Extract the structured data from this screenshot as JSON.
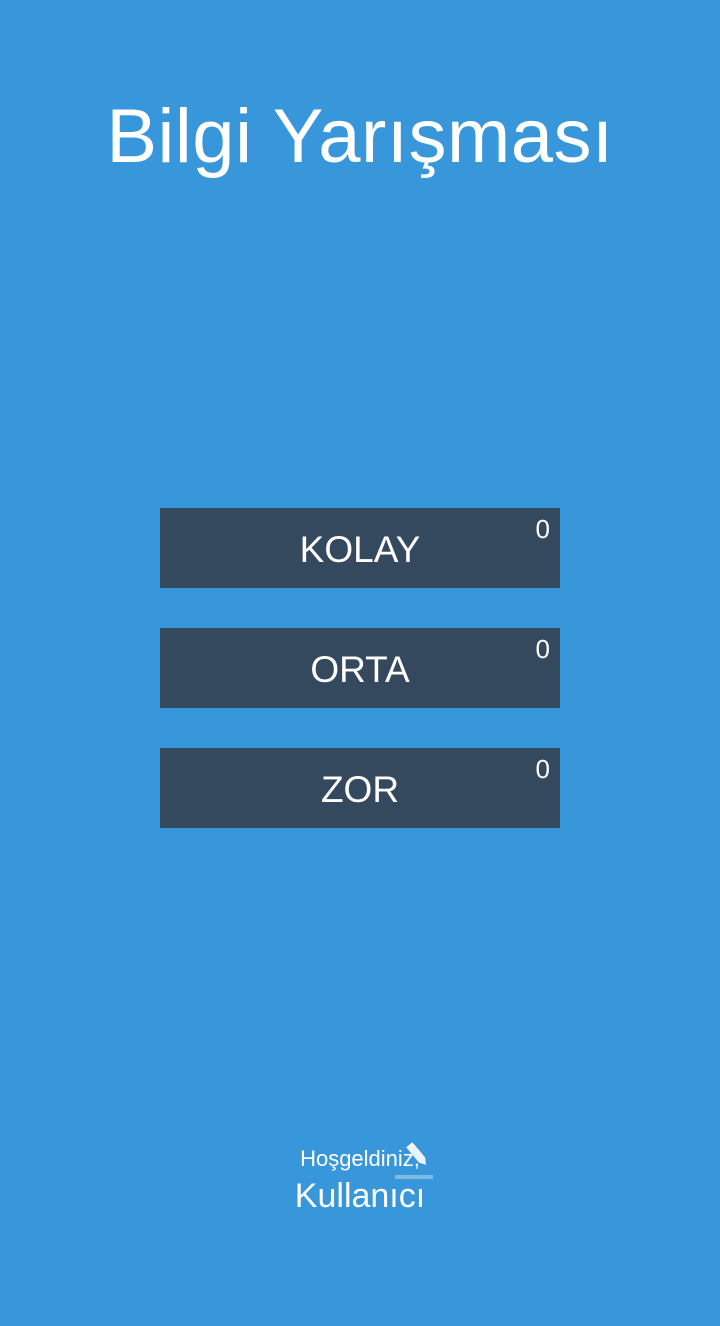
{
  "app": {
    "title": "Bilgi Yarışması"
  },
  "levels": [
    {
      "label": "KOLAY",
      "score": "0"
    },
    {
      "label": "ORTA",
      "score": "0"
    },
    {
      "label": "ZOR",
      "score": "0"
    }
  ],
  "welcome": {
    "greeting": "Hoşgeldiniz,",
    "username": "Kullanıcı",
    "edit_icon": "pencil-edit-icon"
  },
  "colors": {
    "background": "#3897db",
    "button": "#35495e",
    "text": "#ffffff"
  }
}
